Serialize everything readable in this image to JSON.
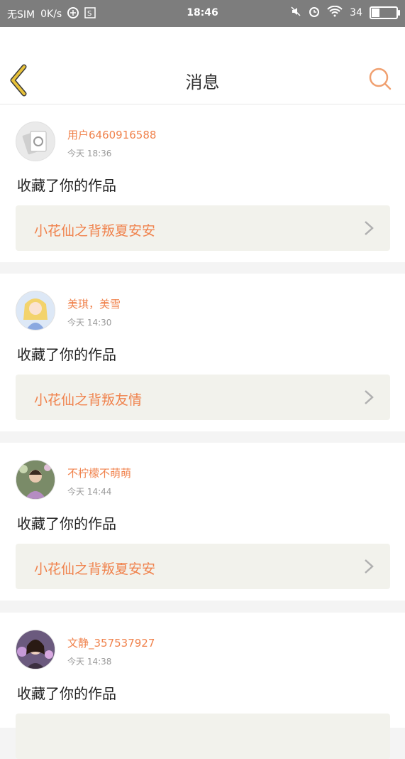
{
  "statusbar": {
    "carrier": "无SIM",
    "speed": "0K/s",
    "time": "18:46",
    "battery_text": "34",
    "battery_level": 0.34
  },
  "header": {
    "title": "消息"
  },
  "messages": [
    {
      "user": "用户6460916588",
      "time": "今天 18:36",
      "action": "收藏了你的作品",
      "work_title": "小花仙之背叛夏安安"
    },
    {
      "user": "美琪，美雪",
      "time": "今天 14:30",
      "action": "收藏了你的作品",
      "work_title": "小花仙之背叛友情"
    },
    {
      "user": "不柠檬不萌萌",
      "time": "今天 14:44",
      "action": "收藏了你的作品",
      "work_title": "小花仙之背叛夏安安"
    },
    {
      "user": "文静_357537927",
      "time": "今天 14:38",
      "action": "收藏了你的作品",
      "work_title": ""
    }
  ],
  "colors": {
    "accent": "#f0824c",
    "back_icon": "#e8c23a",
    "statusbar": "#7d7d7d"
  }
}
